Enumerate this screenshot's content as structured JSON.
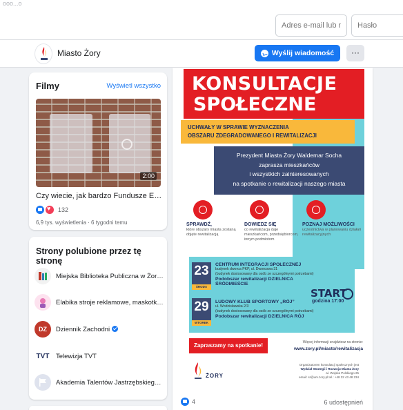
{
  "topbar": {
    "corner_text": "ooo...o",
    "email_placeholder": "Adres e-mail lub numer",
    "password_placeholder": "Hasło"
  },
  "page": {
    "name": "Miasto Żory",
    "message_button": "Wyślij wiadomość",
    "more_button": "···"
  },
  "films": {
    "heading": "Filmy",
    "see_all": "Wyświetl wszystko",
    "video": {
      "duration": "2:00",
      "title": "Czy wiecie, jak bardzo Fundusze Europej...",
      "reactions": "132",
      "meta": "6,9 tys. wyświetlenia · 6 tygodni temu"
    }
  },
  "liked_pages": {
    "heading": "Strony polubione przez tę stronę",
    "items": [
      {
        "name": "Miejska Biblioteka Publiczna w Żorach",
        "avatar": "",
        "verified": false
      },
      {
        "name": "Elabika stroje reklamowe, maskotki re...",
        "avatar": "",
        "verified": false
      },
      {
        "name": "Dziennik Zachodni",
        "avatar": "DZ",
        "verified": true
      },
      {
        "name": "Telewizja TVT",
        "avatar": "TVT",
        "verified": false
      },
      {
        "name": "Akademia Talentów Jastrzębskiego W...",
        "avatar": "",
        "verified": false
      }
    ]
  },
  "post": {
    "poster": {
      "title1": "KONSULTACJE",
      "title2": "SPOŁECZNE",
      "band1": "UCHWAŁY W SPRAWIE WYZNACZENIA",
      "band2": "OBSZARU ZDEGRADOWANEGO I REWITALIZACJI",
      "invite1": "Prezydent Miasta Żory Waldemar Socha",
      "invite2": "zaprasza mieszkańców",
      "invite3": "i wszystkich zainteresowanych",
      "invite4": "na spotkanie o rewitalizacji naszego miasta",
      "cols": [
        {
          "title": "SPRAWDŹ,",
          "desc": "które obszary miasta zostaną objęte rewitalizacją"
        },
        {
          "title": "DOWIEDZ SIĘ",
          "desc": "co rewitalizacja daje mieszkańcom, przedsiębiorcom, innym podmiotom"
        },
        {
          "title": "POZNAJ MOŻLIWOŚCI",
          "desc": "uczestnictwa w planowaniu działań rewitalizacyjnych"
        }
      ],
      "events": [
        {
          "day": "23",
          "weekday": "ŚRODA",
          "place": "CENTRUM INTEGRACJI SPOŁECZNEJ",
          "addr1": "budynek dworca PKP, ul. Dworcowa 31",
          "addr2": "(budynek dostosowany dla osób ze szczególnymi potrzebami)",
          "subarea": "Podobszar rewitalizacji DZIELNICA ŚRÓDMIEŚCIE"
        },
        {
          "day": "29",
          "weekday": "WTOREK",
          "place": "LUDOWY KLUB SPORTOWY „RÓJ”",
          "addr1": "ul. Wodzisławska 2/3",
          "addr2": "(budynek dostosowany dla osób ze szczególnymi potrzebami)",
          "subarea": "Podobszar rewitalizacji DZIELNICA RÓJ"
        }
      ],
      "start": "START",
      "time": "godzina 17:00",
      "invite_button": "Zapraszamy na spotkanie!",
      "more_info": "Więcej informacji znajdziesz na stronie:",
      "url": "www.zory.pl/miasto/rewitalizacja",
      "logo_text": "ŻORY",
      "organizer1": "Organizatorem konsultacji społecznych jest",
      "organizer2": "Wydział Strategii i Rozwoju Miasta Żory",
      "organizer3": "al. Wojska Polskiego 25",
      "organizer4": "email: sr@um.zory.pl   tel.: +48 32 43 48 234"
    },
    "likes": "4",
    "shares": "6 udostępnień"
  },
  "colors": {
    "accent": "#1877f2",
    "poster_red": "#e31e24",
    "poster_navy": "#3b4a73",
    "poster_cyan": "#6ed1db",
    "poster_yellow": "#f9b83b"
  }
}
